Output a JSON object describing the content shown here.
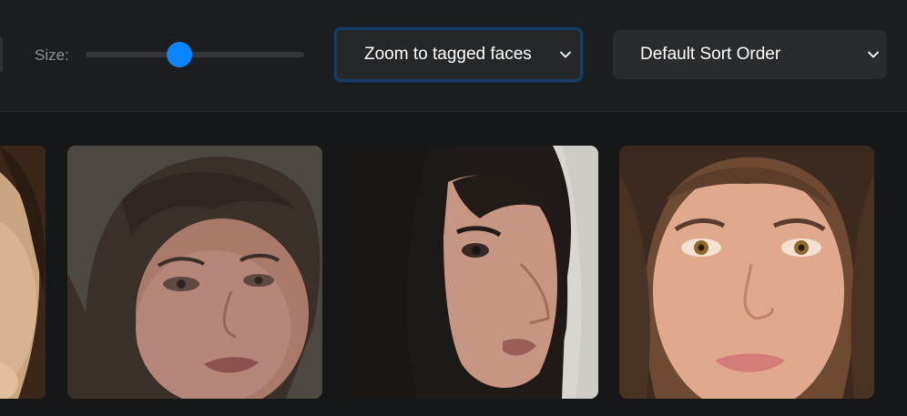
{
  "toolbar": {
    "size_label": "Size:",
    "size_slider": {
      "value_fraction": 0.43,
      "accent_color": "#0a84ff"
    },
    "zoom_select": {
      "selected": "Zoom to tagged faces",
      "focused": true,
      "icon": "chevron-down-icon"
    },
    "sort_select": {
      "selected": "Default Sort Order",
      "icon": "chevron-down-icon"
    }
  },
  "gallery": {
    "items": [
      {
        "kind": "face-photo",
        "partially_visible": true
      },
      {
        "kind": "face-photo"
      },
      {
        "kind": "face-photo"
      },
      {
        "kind": "face-photo"
      }
    ]
  }
}
